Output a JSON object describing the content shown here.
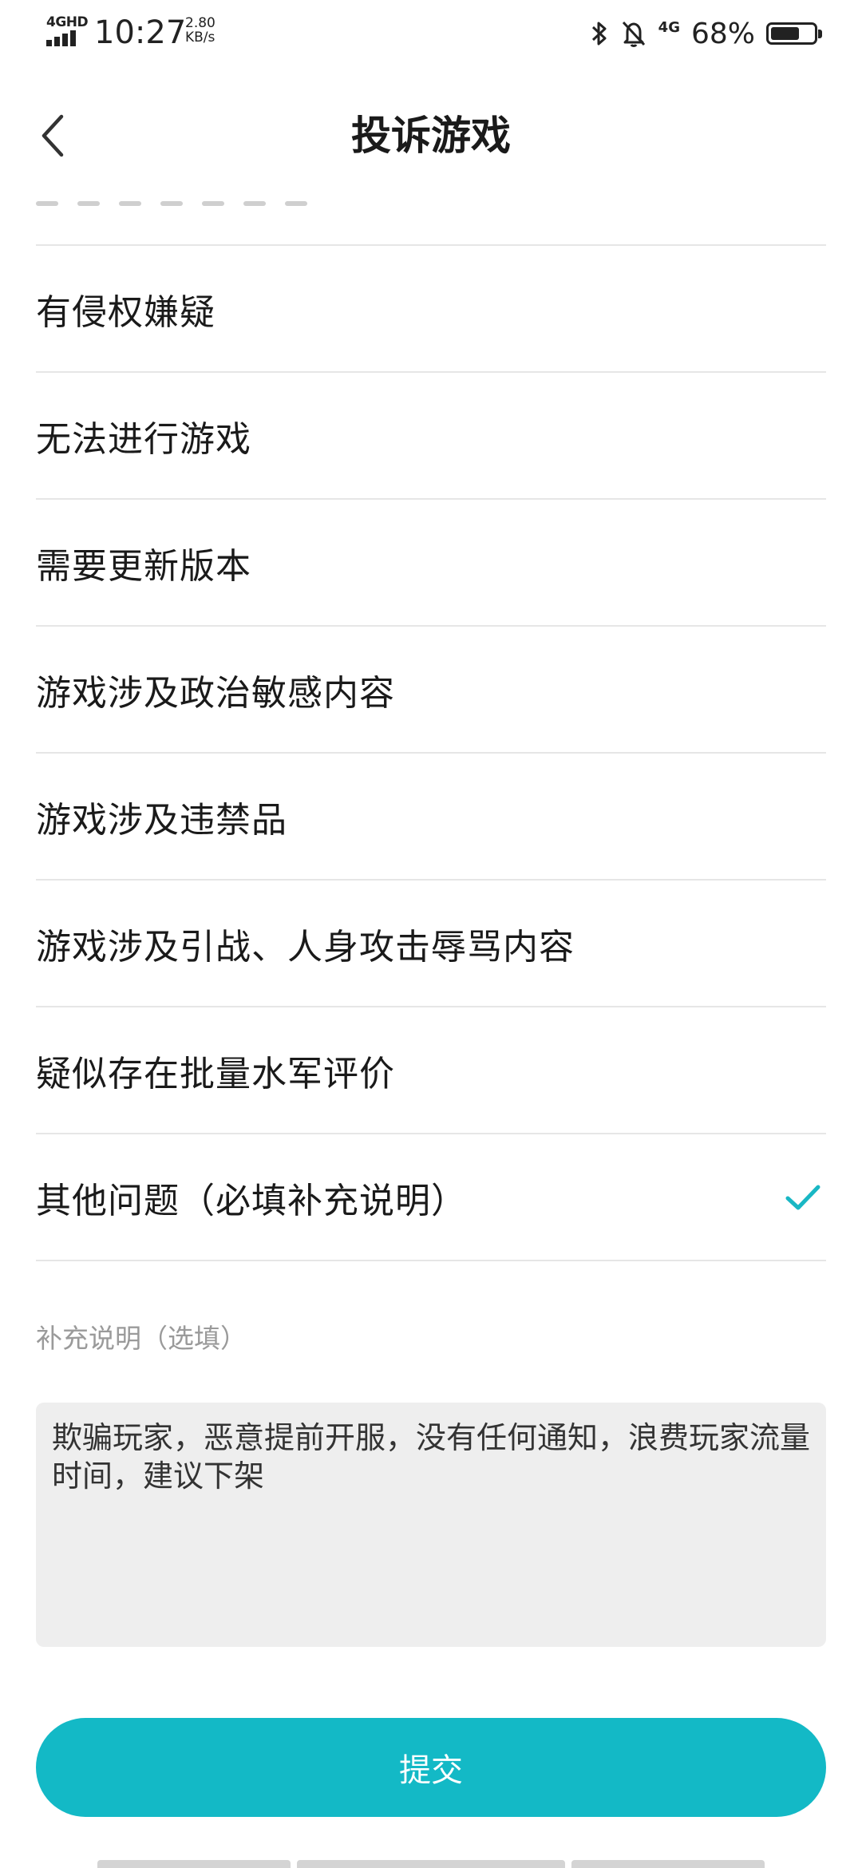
{
  "status_bar": {
    "network": "4GHD",
    "time": "10:27",
    "speed_value": "2.80",
    "speed_unit": "KB/s",
    "cell_type": "4G",
    "battery_text": "68%",
    "battery_level": 0.68,
    "icons": [
      "bluetooth-icon",
      "mute-bell-icon",
      "battery-icon"
    ]
  },
  "header": {
    "title": "投诉游戏",
    "back_icon": "chevron-left-icon"
  },
  "complaint_options": [
    {
      "label": "有侵权嫌疑",
      "selected": false
    },
    {
      "label": "无法进行游戏",
      "selected": false
    },
    {
      "label": "需要更新版本",
      "selected": false
    },
    {
      "label": "游戏涉及政治敏感内容",
      "selected": false
    },
    {
      "label": "游戏涉及违禁品",
      "selected": false
    },
    {
      "label": "游戏涉及引战、人身攻击辱骂内容",
      "selected": false
    },
    {
      "label": "疑似存在批量水军评价",
      "selected": false
    },
    {
      "label": "其他问题（必填补充说明）",
      "selected": true
    }
  ],
  "supplement": {
    "label": "补充说明（选填）",
    "value": "欺骗玩家，恶意提前开服，没有任何通知，浪费玩家流量时间，建议下架"
  },
  "submit": {
    "label": "提交"
  },
  "colors": {
    "accent": "#13b9c6",
    "check": "#19b7c4",
    "divider": "#e6e6e6",
    "input_bg": "#eeeeee",
    "hint_text": "#9a9a9a"
  }
}
